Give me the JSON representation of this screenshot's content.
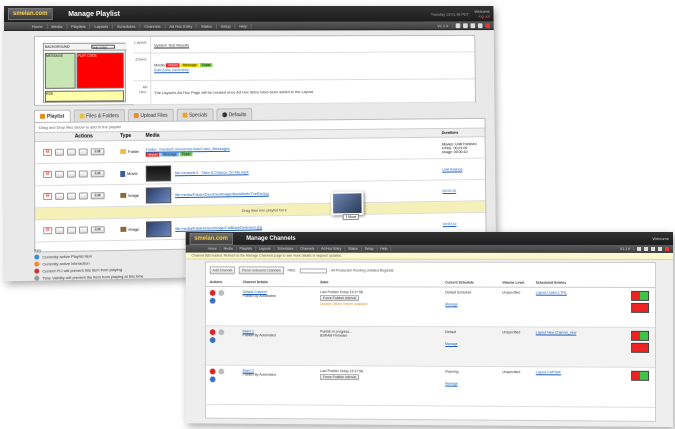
{
  "win1": {
    "logo": "smelan.com",
    "title": "Manage Playlist",
    "date": "Tuesday 13:01:48 PDT",
    "user": "Welcome",
    "logout": "log out",
    "nav": [
      "Home",
      "Media",
      "Playlists",
      "Layouts",
      "Schedules",
      "Channels",
      "Ad Hoc Entry",
      "Status",
      "Setup",
      "Help"
    ],
    "version": "V1.1.9",
    "layout": {
      "bg_label": "BACKGROUND",
      "tag_label": "TAB CODE",
      "msg_label": "MESSAGE",
      "red_label": "PLAY CODE",
      "rss_label": "RSS",
      "rows": [
        {
          "key": "Layout:",
          "value": "System Test Results"
        },
        {
          "key": "Zones:",
          "value": "Media",
          "chips": [
            "Vessel",
            "Message",
            "Ticker"
          ],
          "link": "Edit Zone Geometry"
        },
        {
          "key": "Ad Hoc:",
          "value": "The Layout's Ad Hoc Page will be created once Ad Hoc items have been added to the Layout."
        }
      ]
    },
    "tabs": [
      "Playlist",
      "Files & Folders",
      "Upload Files",
      "Specials",
      "Defaults"
    ],
    "hint": "Drag and Drop files below to add to the playlist",
    "headers": {
      "actions": "Actions",
      "type": "Type",
      "media": "Media",
      "durations": "Durations"
    },
    "rows": [
      {
        "type": "Folder",
        "media": "Folder: /media/Commercial Ads/Caris_Messages",
        "chips": [
          "Vessel",
          "Message",
          "Ticker"
        ],
        "duration": [
          "Movies: Until Finished",
          "HTML: 00:01:00",
          "Image: 00:00:10"
        ]
      },
      {
        "type": "Movie",
        "media": "file:media/8.0 - Take A Chance On Me.mp4",
        "duration": [
          "Until finished"
        ]
      },
      {
        "type": "Image",
        "media": "file:media/Folder/Dec/DecIImage/BackBoth/TheEiaJpg",
        "duration": [
          "00:00:10"
        ]
      },
      {
        "type": "Image",
        "media": "file:media/Folder/Dec/Image/CalBlackDelicious.jpg",
        "duration": [
          "00:00:10"
        ]
      }
    ],
    "drop_text": "Drag files into playlist here",
    "drag_tag": "1 Move",
    "edit_label": "Edit",
    "key_title": "Key",
    "key_items": [
      "Currently active Playlist item",
      "Currently active Interaction",
      "Current PLI will prevent this item from playing",
      "Time Validity will prevent the item from playing at this time"
    ]
  },
  "win2": {
    "logo": "smelan.com",
    "title": "Manage Channels",
    "user": "Welcome",
    "nav": [
      "Home",
      "Media",
      "Playlists",
      "Layouts",
      "Schedules",
      "Channels",
      "Ad Hoc Entry",
      "Status",
      "Setup",
      "Help"
    ],
    "version": "V1.1.9",
    "notice": "Channel lists loaded. Refresh to the Manage Channels page to see more details or request updates.",
    "filter": {
      "add_label": "Add Channel",
      "prune_label": "Prune Unbound Channels",
      "filter_label": "Filter:",
      "radios": "All   Production   Pending   Unlisted Registrat"
    },
    "headers": [
      "Actions",
      "Channel Details",
      "State",
      "Current Schedule",
      "Volume Level",
      "Scheduled Entries"
    ],
    "rows": [
      {
        "name": "Default Channel",
        "sub": "Publish By Automated",
        "state": "Last Publish  Today 15:37:58",
        "state2": "Force Publish  Interval",
        "warn": "Update Offline Viewer available",
        "sched": "Default Schedule",
        "vol": "Unspecified",
        "ent": "Layout Cullen's TRL",
        "link": "Manage"
      },
      {
        "name": "Bazm 1",
        "sub": "Publish By Automated",
        "state": "Publish in progress...",
        "state2": "BSRAM Firmware",
        "warn": "",
        "sched": "Default",
        "vol": "Unspecified",
        "ent": "Layout New Channel_new",
        "link": "Manage"
      },
      {
        "name": "Bazm 2",
        "sub": "Publish By Automated",
        "state": "Last Publish  Today 15:37:58",
        "state2": "Force Publish  Interval",
        "warn": "",
        "sched": "Planning",
        "vol": "Unspecified",
        "ent": "Layout CAPSBF",
        "link": "Manage"
      }
    ]
  }
}
